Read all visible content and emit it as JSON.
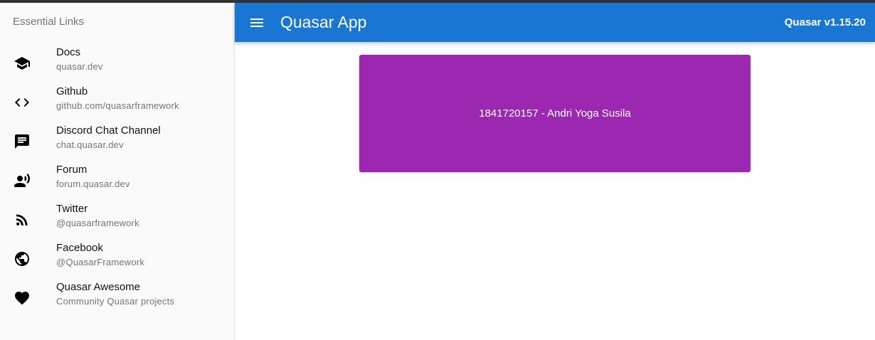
{
  "drawer": {
    "header": "Essential Links",
    "items": [
      {
        "title": "Docs",
        "caption": "quasar.dev",
        "icon": "school-icon"
      },
      {
        "title": "Github",
        "caption": "github.com/quasarframework",
        "icon": "code-icon"
      },
      {
        "title": "Discord Chat Channel",
        "caption": "chat.quasar.dev",
        "icon": "chat-icon"
      },
      {
        "title": "Forum",
        "caption": "forum.quasar.dev",
        "icon": "record-voice-icon"
      },
      {
        "title": "Twitter",
        "caption": "@quasarframework",
        "icon": "rss-feed-icon"
      },
      {
        "title": "Facebook",
        "caption": "@QuasarFramework",
        "icon": "public-icon"
      },
      {
        "title": "Quasar Awesome",
        "caption": "Community Quasar projects",
        "icon": "favorite-icon"
      }
    ]
  },
  "header": {
    "menu_icon": "menu-icon",
    "title": "Quasar App",
    "version": "Quasar v1.15.20"
  },
  "main": {
    "card_text": "1841720157 - Andri Yoga Susila"
  },
  "colors": {
    "header": "#1976d2",
    "card": "#9c27b0",
    "drawer": "#fafafa"
  }
}
